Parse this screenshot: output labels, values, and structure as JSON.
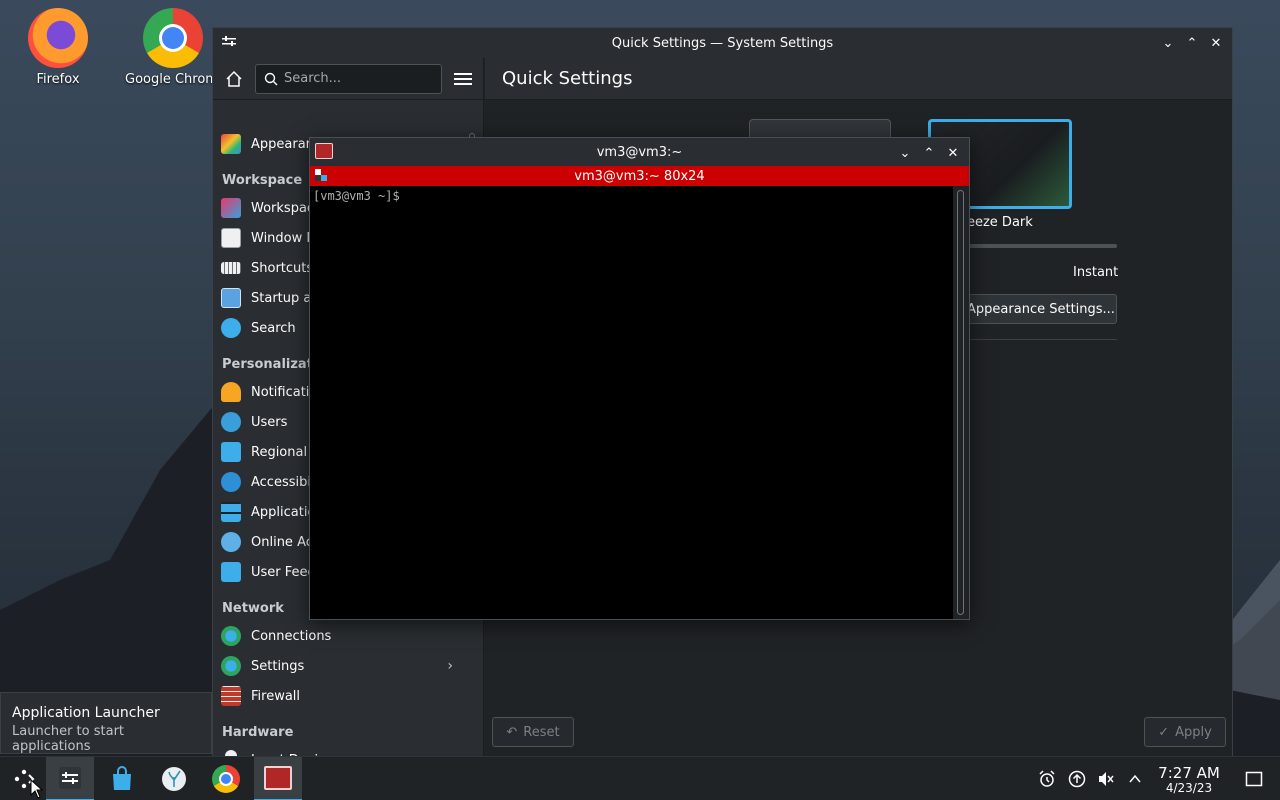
{
  "desktop": {
    "icons": [
      {
        "label": "Firefox"
      },
      {
        "label": "Google Chrome"
      }
    ]
  },
  "settings_window": {
    "title": "Quick Settings — System Settings",
    "search_placeholder": "Search...",
    "sidebar": {
      "appearance": "Appearance",
      "sections": {
        "workspace": "Workspace",
        "personalization": "Personalization",
        "network": "Network",
        "hardware": "Hardware"
      },
      "workspace_items": [
        "Workspace Behavior",
        "Window Management",
        "Shortcuts",
        "Startup and Shutdown",
        "Search"
      ],
      "personalization_items": [
        "Notifications",
        "Users",
        "Regional Settings",
        "Accessibility",
        "Applications",
        "Online Accounts",
        "User Feedback"
      ],
      "network_items": [
        "Connections",
        "Settings",
        "Firewall"
      ],
      "hardware_items": [
        "Input Devices"
      ]
    },
    "page_title": "Quick Settings",
    "theme_label": "Breeze Dark",
    "animation_speed_label": "Instant",
    "appearance_settings_button": "Appearance Settings...",
    "reset_button": "Reset",
    "apply_button": "Apply"
  },
  "terminal_window": {
    "title": "vm3@vm3:~",
    "tab_title": "vm3@vm3:~ 80x24",
    "prompt": "[vm3@vm3 ~]$"
  },
  "tooltip": {
    "title": "Application Launcher",
    "subtitle": "Launcher to start applications"
  },
  "taskbar": {
    "time": "7:27 AM",
    "date": "4/23/23"
  },
  "colors": {
    "accent": "#3daee9",
    "terminal_tab": "#cc0000",
    "window_bg": "#202326"
  }
}
